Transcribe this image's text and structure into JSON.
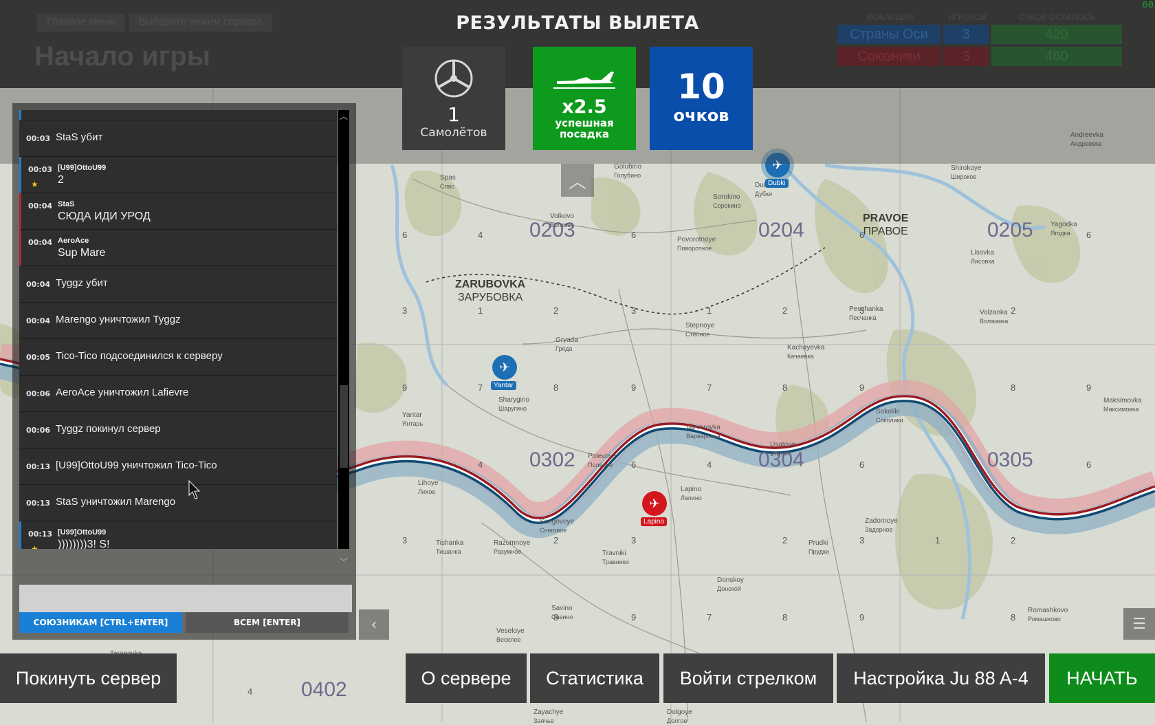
{
  "fps": "60",
  "breadcrumb": [
    "Главное меню",
    "Выберите режим сервера"
  ],
  "page_title": "Начало игры",
  "coalitions": {
    "headers": [
      "КОАЛИЦИЯ",
      "ИГРОКОВ",
      "ОЧКОВ ОСТАЛОСЬ"
    ],
    "rows": [
      {
        "name": "Страны Оси",
        "players": "3",
        "points": "420",
        "color": "#1c4f86"
      },
      {
        "name": "Союзники",
        "players": "3",
        "points": "460",
        "color": "#8a1f24"
      }
    ]
  },
  "results": {
    "title": "РЕЗУЛЬТАТЫ ВЫЛЕТА",
    "planes_value": "1",
    "planes_label": "Самолётов",
    "landing_value": "x2.5",
    "landing_label_1": "успешная",
    "landing_label_2": "посадка",
    "points_value": "10",
    "points_label": "очков"
  },
  "chat": {
    "messages": [
      {
        "time": "00:03",
        "text": "StaS убит",
        "stripe": ""
      },
      {
        "time": "00:03",
        "sender": "[U99]OttoU99",
        "msg": "2",
        "stripe": "blue",
        "star": true
      },
      {
        "time": "00:04",
        "sender": "StaS",
        "msg": "СЮДА ИДИ УРОД",
        "stripe": "red"
      },
      {
        "time": "00:04",
        "sender": "AeroAce",
        "msg": "Sup Mare",
        "stripe": "red"
      },
      {
        "time": "00:04",
        "text": "Tyggz убит",
        "stripe": ""
      },
      {
        "time": "00:04",
        "text": "Marengo уничтожил Tyggz",
        "stripe": ""
      },
      {
        "time": "00:05",
        "text": "Tico-Tico подсоединился к серверу",
        "stripe": ""
      },
      {
        "time": "00:06",
        "text": "AeroAce уничтожил Lafievre",
        "stripe": ""
      },
      {
        "time": "00:06",
        "text": "Tyggz покинул сервер",
        "stripe": ""
      },
      {
        "time": "00:13",
        "text": "[U99]OttoU99 уничтожил Tico-Tico",
        "stripe": ""
      },
      {
        "time": "00:13",
        "text": "StaS уничтожил Marengo",
        "stripe": ""
      },
      {
        "time": "00:13",
        "sender": "[U99]OttoU99",
        "msg": "))))))))3! S!",
        "stripe": "blue",
        "star": true
      }
    ],
    "input_placeholder": "",
    "tab_allies": "СОЮЗНИКАМ [CTRL+ENTER]",
    "tab_all": "ВСЕМ [ENTER]"
  },
  "buttons": {
    "leave": "Покинуть сервер",
    "about": "О сервере",
    "stats": "Статистика",
    "gunner": "Войти стрелком",
    "setup": "Настройка Ju 88 A-4",
    "start": "НАЧАТЬ"
  },
  "colors": {
    "start_green": "#0e8c1b",
    "allies_blue": "#1a80d6",
    "landing_green": "#0d9a1d",
    "points_blue": "#0a4eac"
  },
  "map": {
    "grid_labels": [
      "0203",
      "0204",
      "0205",
      "0302",
      "0304",
      "0305",
      "0402"
    ],
    "big_towns": [
      {
        "lat": "ZARUBOVKA",
        "cyr": "ЗАРУБОВКА"
      },
      {
        "lat": "PRAVOE",
        "cyr": "ПРАВОЕ"
      }
    ],
    "towns": [
      {
        "lat": "Spas",
        "cyr": "Спас"
      },
      {
        "lat": "Volkovo",
        "cyr": "Волково"
      },
      {
        "lat": "Golubino",
        "cyr": "Голубино"
      },
      {
        "lat": "Sorokino",
        "cyr": "Сорокино"
      },
      {
        "lat": "Povorotnoye",
        "cyr": "Поворотное"
      },
      {
        "lat": "Yagodka",
        "cyr": "Ягодка"
      },
      {
        "lat": "Lisovka",
        "cyr": "Лисовка"
      },
      {
        "lat": "Andreevka",
        "cyr": "Андреевка"
      },
      {
        "lat": "Shirokoye",
        "cyr": "Широкое"
      },
      {
        "lat": "Peschanka",
        "cyr": "Песчанка"
      },
      {
        "lat": "Volzanka",
        "cyr": "Волжанка"
      },
      {
        "lat": "Stepnoye",
        "cyr": "Степное"
      },
      {
        "lat": "Gryada",
        "cyr": "Гряда"
      },
      {
        "lat": "Kachayevka",
        "cyr": "Качаевка"
      },
      {
        "lat": "Sharygino",
        "cyr": "Шаругино"
      },
      {
        "lat": "Yantar",
        "cyr": "Янтарь"
      },
      {
        "lat": "Maksimovka",
        "cyr": "Максимовка"
      },
      {
        "lat": "Varvarovka",
        "cyr": "Варваровка"
      },
      {
        "lat": "Sokoliki",
        "cyr": "Соколики"
      },
      {
        "lat": "Usatoye",
        "cyr": "Усатое"
      },
      {
        "lat": "Polevoye",
        "cyr": "Полевое"
      },
      {
        "lat": "Lihoye",
        "cyr": "Лихое"
      },
      {
        "lat": "Lapino",
        "cyr": "Лапино"
      },
      {
        "lat": "Snegovoye",
        "cyr": "Снеговое"
      },
      {
        "lat": "Razumnoye",
        "cyr": "Разумное"
      },
      {
        "lat": "Tishanka",
        "cyr": "Тишанка"
      },
      {
        "lat": "Travniki",
        "cyr": "Травники"
      },
      {
        "lat": "Prudki",
        "cyr": "Прудки"
      },
      {
        "lat": "Zadornoye",
        "cyr": "Задорное"
      },
      {
        "lat": "Donskoy",
        "cyr": "Донской"
      },
      {
        "lat": "Savino",
        "cyr": "Савино"
      },
      {
        "lat": "Veseloye",
        "cyr": "Веселое"
      },
      {
        "lat": "Romashkovo",
        "cyr": "Ромашково"
      },
      {
        "lat": "Zayachye",
        "cyr": "Заячье"
      },
      {
        "lat": "Dolgoye",
        "cyr": "Долгое"
      },
      {
        "lat": "Tarapovka",
        "cyr": ""
      },
      {
        "lat": "Dubki",
        "cyr": "Дубки"
      }
    ],
    "airfields": [
      {
        "label": "Dubki",
        "side": "axis"
      },
      {
        "label": "Yantar",
        "side": "axis"
      },
      {
        "label": "Lapino",
        "side": "allies"
      }
    ]
  }
}
